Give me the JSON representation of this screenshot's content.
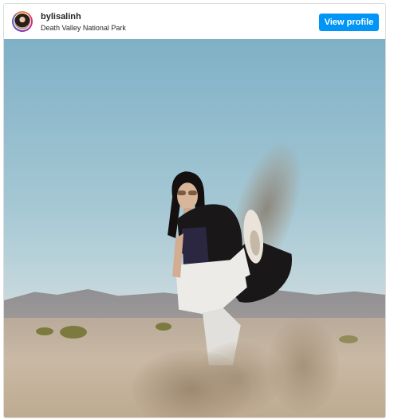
{
  "post": {
    "username": "bylisalinh",
    "location": "Death Valley National Park",
    "view_profile_label": "View profile"
  },
  "icons": {
    "avatar": "profile-avatar"
  }
}
